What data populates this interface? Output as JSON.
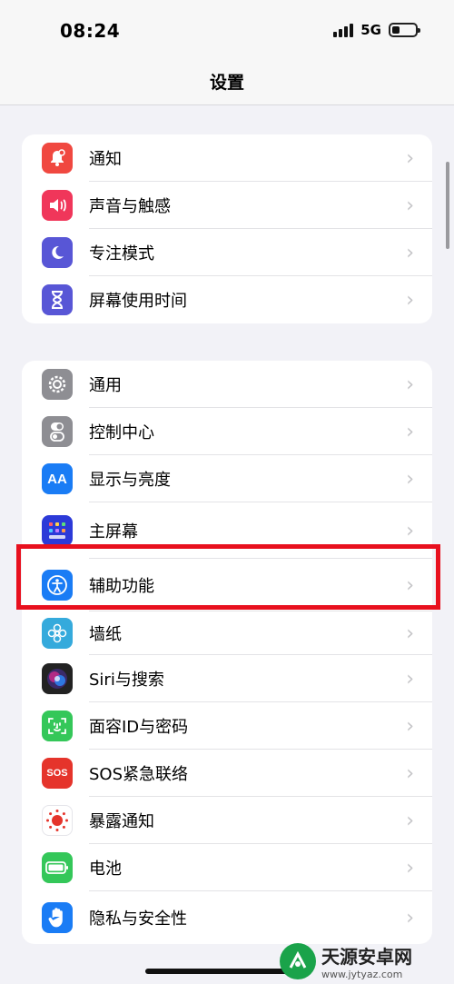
{
  "status_bar": {
    "time": "08:24",
    "network": "5G",
    "battery_level": 0.35
  },
  "header": {
    "title": "设置"
  },
  "group1": [
    {
      "name": "notifications",
      "label": "通知",
      "icon": "bell-icon",
      "color": "#f04840"
    },
    {
      "name": "sounds",
      "label": "声音与触感",
      "icon": "speaker-icon",
      "color": "#f0365a"
    },
    {
      "name": "focus",
      "label": "专注模式",
      "icon": "moon-icon",
      "color": "#5856d6"
    },
    {
      "name": "screen-time",
      "label": "屏幕使用时间",
      "icon": "hourglass-icon",
      "color": "#5856d6"
    }
  ],
  "group2": [
    {
      "name": "general",
      "label": "通用",
      "icon": "gear-icon",
      "color": "#8e8e93"
    },
    {
      "name": "control-center",
      "label": "控制中心",
      "icon": "toggle-icon",
      "color": "#8e8e93"
    },
    {
      "name": "display",
      "label": "显示与亮度",
      "icon": "text-size-icon",
      "color": "#1a7cf5"
    },
    {
      "name": "home-screen",
      "label": "主屏幕",
      "icon": "app-grid-icon",
      "color": "#2c3ad8"
    },
    {
      "name": "accessibility",
      "label": "辅助功能",
      "icon": "accessibility-icon",
      "color": "#1a7cf5"
    },
    {
      "name": "wallpaper",
      "label": "墙纸",
      "icon": "flower-icon",
      "color": "#35aadc"
    },
    {
      "name": "siri",
      "label": "Siri与搜索",
      "icon": "siri-icon",
      "color": "#222222"
    },
    {
      "name": "face-id",
      "label": "面容ID与密码",
      "icon": "face-id-icon",
      "color": "#34c759"
    },
    {
      "name": "sos",
      "label": "SOS紧急联络",
      "icon": "sos-icon",
      "color": "#e5342b"
    },
    {
      "name": "exposure",
      "label": "暴露通知",
      "icon": "exposure-icon",
      "color": "#ffffff"
    },
    {
      "name": "battery",
      "label": "电池",
      "icon": "battery-icon",
      "color": "#34c759"
    },
    {
      "name": "privacy",
      "label": "隐私与安全性",
      "icon": "hand-icon",
      "color": "#1a7cf5"
    }
  ],
  "icon_text": {
    "display": "AA",
    "sos": "SOS"
  },
  "watermark": {
    "name": "天源安卓网",
    "url": "www.jytyaz.com"
  },
  "colors": {
    "highlight": "#e8101e",
    "background": "#f2f2f7"
  }
}
